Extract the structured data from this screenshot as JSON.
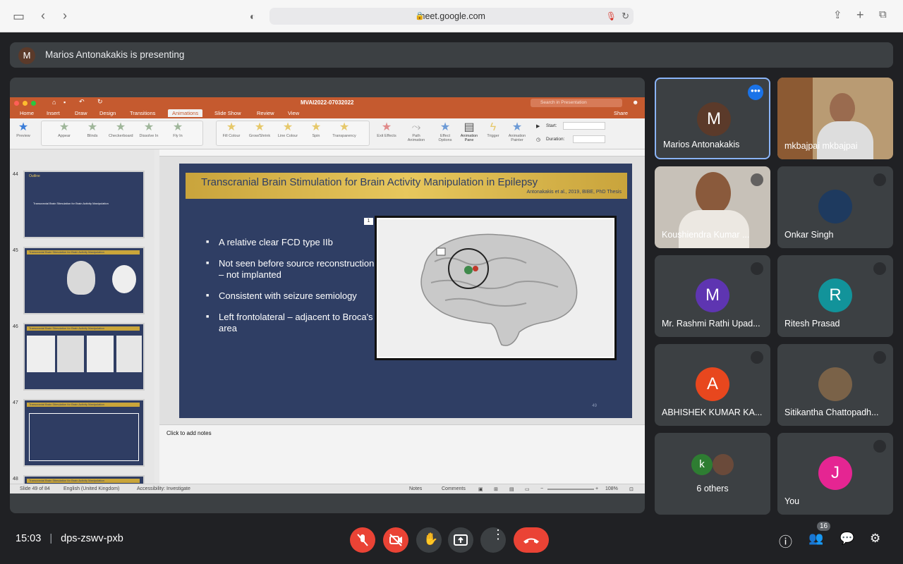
{
  "browser": {
    "url": "meet.google.com"
  },
  "banner": {
    "avatar_letter": "M",
    "text": "Marios Antonakakis is presenting"
  },
  "ppt": {
    "filename": "MVAI2022-07032022",
    "search_placeholder": "Search in Presentation",
    "share": "Share",
    "tabs": [
      "Home",
      "Insert",
      "Draw",
      "Design",
      "Transitions",
      "Animations",
      "Slide Show",
      "Review",
      "View"
    ],
    "active_tab": "Animations",
    "ribbon": {
      "preview": "Preview",
      "entrance": [
        "Appear",
        "Blinds",
        "Checkerboard",
        "Dissolve In",
        "Fly In"
      ],
      "emphasis": [
        "Fill Colour",
        "Grow/Shrink",
        "Line Colour",
        "Spin",
        "Transparency"
      ],
      "exit": "Exit Effects",
      "path": "Path Animation",
      "options": "Effect Options",
      "pane": "Animation Pane",
      "trigger": "Trigger",
      "painter": "Animation Painter",
      "start": "Start:",
      "duration": "Duration:"
    },
    "thumbnails": [
      {
        "num": "44",
        "title": "Outline",
        "item": "Transcranial Brain Stimulation for Brain Activity Manipulation"
      },
      {
        "num": "45",
        "title": "Transcranial Brain Stimulation for Brain Activity Manipulation"
      },
      {
        "num": "46",
        "title": "Transcranial Brain Stimulation for Brain Activity Manipulation"
      },
      {
        "num": "47",
        "title": "Transcranial Brain Stimulation for Brain Activity Manipulation"
      },
      {
        "num": "48",
        "title": "Transcranial Brain Stimulation for Brain Activity Manipulation"
      }
    ],
    "slide": {
      "title": "Transcranial Brain Stimulation for Brain Activity Manipulation in Epilepsy",
      "citation": "Antonakakis et al., 2019, BIBE, PhD Thesis",
      "bullets": [
        "A relative clear FCD type IIb",
        "Not seen before source reconstruction – not implanted",
        "Consistent with seizure semiology",
        "Left frontolateral – adjacent to Broca's area"
      ],
      "anim_badge": "1",
      "page": "49"
    },
    "notes": "Click to add notes",
    "status": {
      "slide": "Slide 49 of 84",
      "language": "English (United Kingdom)",
      "accessibility": "Accessibility: Investigate",
      "notes": "Notes",
      "comments": "Comments",
      "zoom": "108%"
    }
  },
  "participants": [
    {
      "name": "Marios Antonakakis",
      "avatar": "M",
      "color": "#5b3a2a",
      "selected": true
    },
    {
      "name": "mkbajpai mkbajpai",
      "avatar": "",
      "video": true
    },
    {
      "name": "Koushiendra Kumar ...",
      "avatar": "",
      "video": true,
      "muted": true
    },
    {
      "name": "Onkar Singh",
      "avatar": "",
      "muted": true
    },
    {
      "name": "Mr. Rashmi Rathi Upad...",
      "avatar": "M",
      "color": "#5e35b1",
      "muted": true
    },
    {
      "name": "Ritesh Prasad",
      "avatar": "R",
      "color": "#12939a",
      "muted": true
    },
    {
      "name": "ABHISHEK KUMAR KA...",
      "avatar": "A",
      "color": "#e8471e",
      "muted": true
    },
    {
      "name": "Sitikantha Chattopadh...",
      "avatar": "",
      "muted": true
    },
    {
      "name": "6 others",
      "avatar": "k",
      "color": "#2e7d32"
    },
    {
      "name": "You",
      "avatar": "J",
      "color": "#e52592",
      "muted": true
    }
  ],
  "bottom": {
    "time": "15:03",
    "code": "dps-zswv-pxb",
    "people_count": "16"
  },
  "colors": {
    "accent_red": "#ea4335",
    "tile": "#3c4043",
    "ppt_orange": "#c55a2f"
  }
}
